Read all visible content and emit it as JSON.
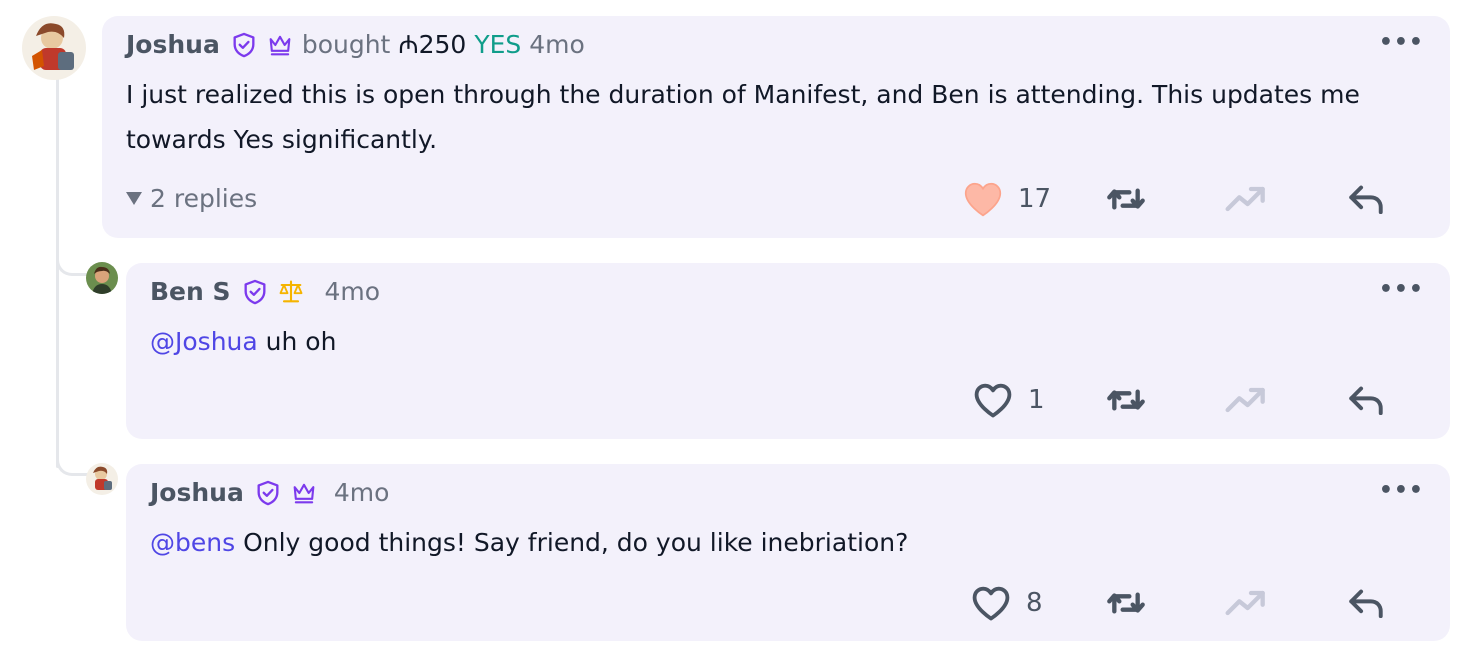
{
  "comments": [
    {
      "author": "Joshua",
      "action_prefix": "bought",
      "amount": "₼250",
      "outcome": "YES",
      "time": "4mo",
      "body": "I just realized this is open through the duration of Manifest, and Ben is attending. This updates me towards Yes significantly.",
      "body_line1": "I just realized this is open through the duration of Manifest, and Ben is attending. This updates me",
      "body_line2": "towards Yes significantly.",
      "replies_label": "2 replies",
      "likes": "17",
      "liked": true,
      "badges": [
        "verified-shield-icon",
        "crown-icon"
      ]
    },
    {
      "author": "Ben S",
      "time": "4mo",
      "mention": "@Joshua",
      "body": "uh oh",
      "likes": "1",
      "liked": false,
      "badges": [
        "verified-shield-icon",
        "scales-icon"
      ]
    },
    {
      "author": "Joshua",
      "time": "4mo",
      "mention": "@bens",
      "body": "Only good things! Say friend, do you like inebriation?",
      "likes": "8",
      "liked": false,
      "badges": [
        "verified-shield-icon",
        "crown-icon"
      ]
    }
  ],
  "more_label": "•••",
  "colors": {
    "card_bg": "#f3f1fb",
    "mention": "#4f46e5",
    "yes_green": "#0f9d8a",
    "badge_purple": "#7c3aed",
    "scales_gold": "#f5b400",
    "liked_heart": "#fdb8a6"
  }
}
